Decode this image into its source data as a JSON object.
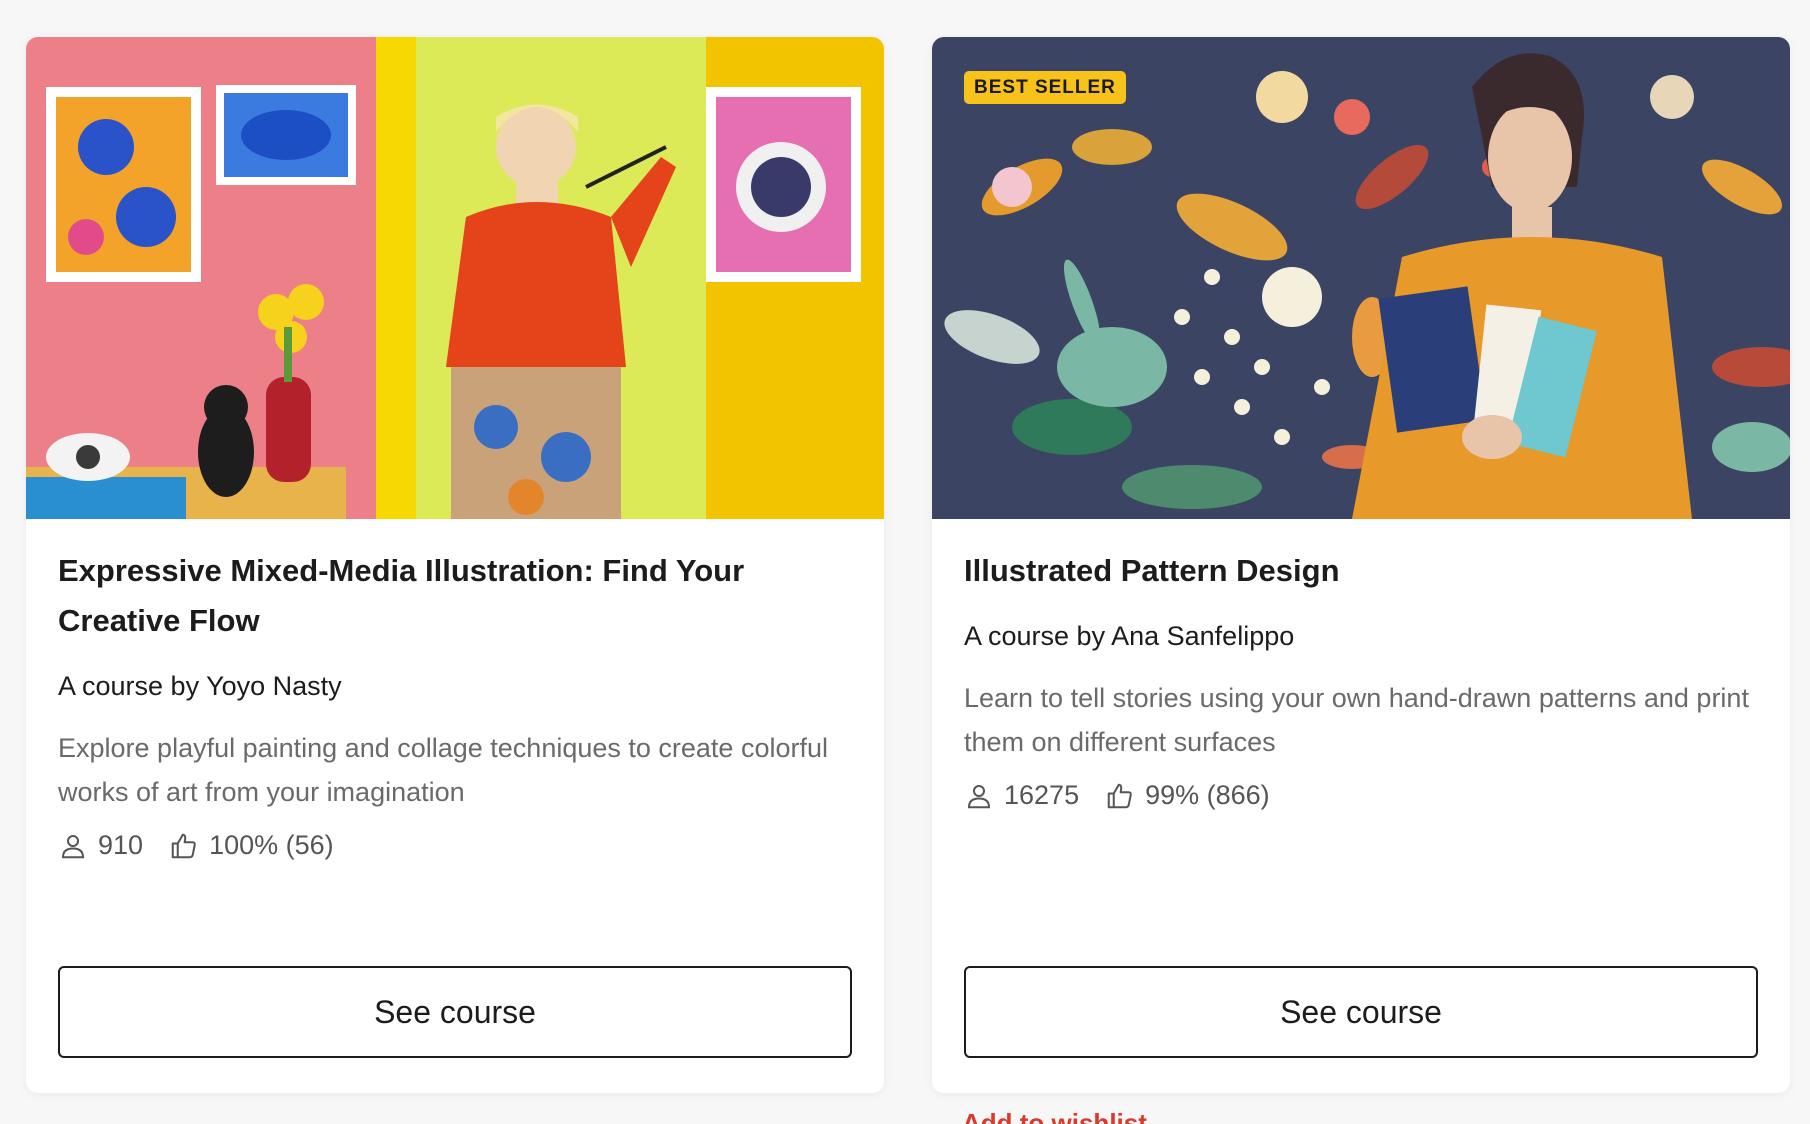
{
  "courses": [
    {
      "title": "Expressive Mixed-Media Illustration: Find Your Creative Flow",
      "author": "A course by Yoyo Nasty",
      "description": "Explore playful painting and collage techniques to create colorful works of art from your imagination",
      "students": "910",
      "rating": "100% (56)",
      "button_label": "See course"
    },
    {
      "badge": "BEST SELLER",
      "title": "Illustrated Pattern Design",
      "author": "A course by Ana Sanfelippo",
      "description": "Learn to tell stories using your own hand-drawn patterns and print them on different surfaces",
      "students": "16275",
      "rating": "99% (866)",
      "button_label": "See course"
    }
  ],
  "peek_link": "Add to wishlist",
  "colors": {
    "badge_bg": "#f7c31a",
    "accent_red": "#d93a2b",
    "text_primary": "#1c1c1c",
    "text_secondary": "#6a6a6a"
  },
  "icons": {
    "students": "user-icon",
    "rating": "thumbs-up-icon"
  }
}
